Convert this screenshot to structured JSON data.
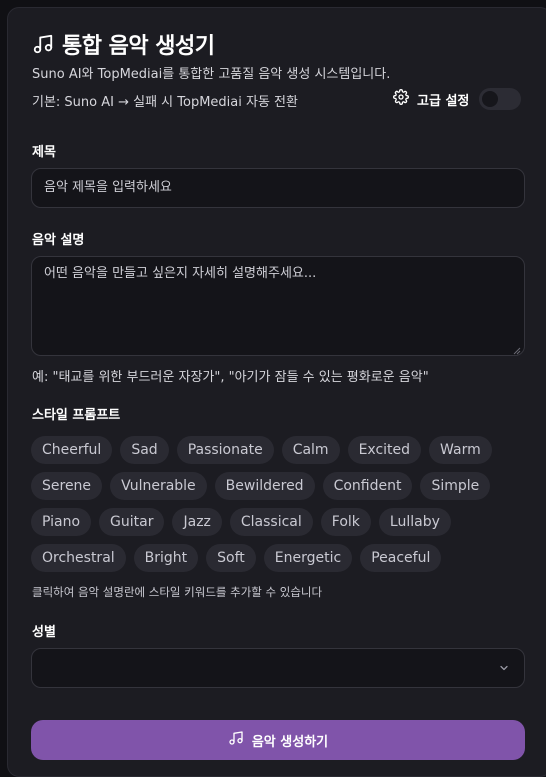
{
  "header": {
    "title": "통합 음악 생성기",
    "subtitle": "Suno AI와 TopMediai를 통합한 고품질 음악 생성 시스템입니다.",
    "fallback_note": "기본: Suno AI → 실패 시 TopMediai 자동 전환",
    "advanced_label": "고급 설정",
    "advanced_enabled": false
  },
  "form": {
    "title_label": "제목",
    "title_placeholder": "음악 제목을 입력하세요",
    "description_label": "음악 설명",
    "description_placeholder": "어떤 음악을 만들고 싶은지 자세히 설명해주세요...",
    "description_example": "예: \"태교를 위한 부드러운 자장가\", \"아기가 잠들 수 있는 평화로운 음악\"",
    "style_label": "스타일 프롬프트",
    "style_chips": [
      "Cheerful",
      "Sad",
      "Passionate",
      "Calm",
      "Excited",
      "Warm",
      "Serene",
      "Vulnerable",
      "Bewildered",
      "Confident",
      "Simple",
      "Piano",
      "Guitar",
      "Jazz",
      "Classical",
      "Folk",
      "Lullaby",
      "Orchestral",
      "Bright",
      "Soft",
      "Energetic",
      "Peaceful"
    ],
    "style_hint": "클릭하여 음악 설명란에 스타일 키워드를 추가할 수 있습니다",
    "gender_label": "성별",
    "gender_value": ""
  },
  "actions": {
    "generate_label": "음악 생성하기"
  },
  "colors": {
    "background": "#101014",
    "card": "#1c1c22",
    "accent": "#8054aa",
    "chip": "#2a2a32"
  }
}
